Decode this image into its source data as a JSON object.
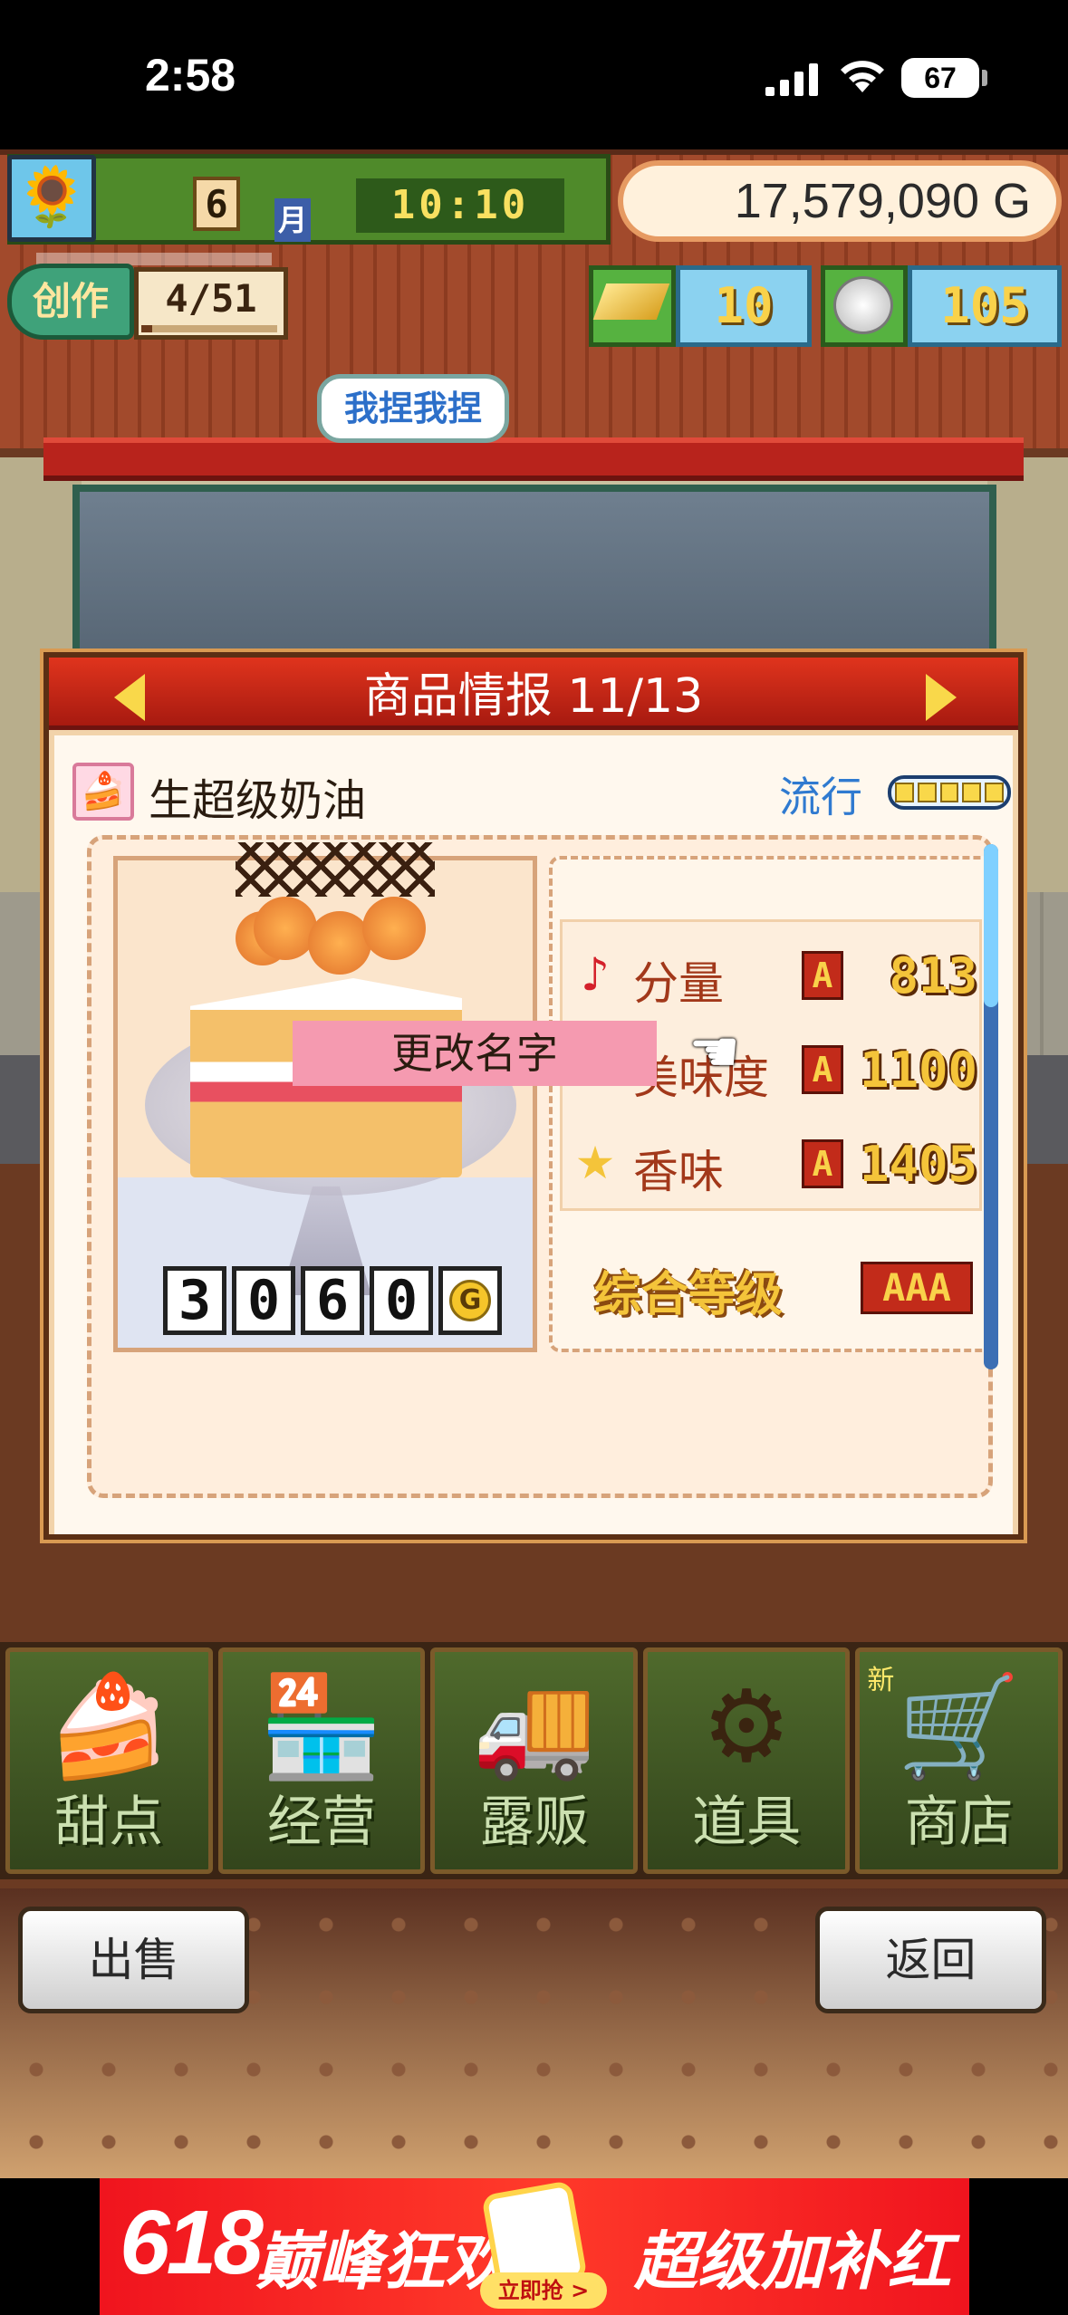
{
  "status_bar": {
    "time": "2:58",
    "battery": "67"
  },
  "hud": {
    "month": "6",
    "month_label": "月",
    "clock": "10:10",
    "money": "17,579,090 G",
    "create_label": "创作",
    "create_count": "4/51",
    "create_progress": 0.08,
    "gold_count": "10",
    "coin_count": "105"
  },
  "speech_bubble": "我捏我捏",
  "dialog": {
    "title": "商品情报 11/13",
    "product_name": "生超级奶油",
    "trend_label": "流行",
    "trend_level": 5,
    "price_digits": [
      "3",
      "0",
      "6",
      "0"
    ],
    "price_unit": "G",
    "stats": [
      {
        "icon": "music-note-icon",
        "glyph": "♪",
        "color": "#d4202a",
        "label": "分量",
        "grade": "A",
        "value": "813"
      },
      {
        "icon": "heart-icon",
        "glyph": "♥",
        "color": "#ff4fa0",
        "label": "美味度",
        "grade": "A",
        "value": "1100"
      },
      {
        "icon": "star-icon",
        "glyph": "★",
        "color": "#f4c43a",
        "label": "香味",
        "grade": "A",
        "value": "1405"
      }
    ],
    "overall_label": "综合等级",
    "overall_grade": "AAA",
    "rename_label": "更改名字"
  },
  "menu": [
    {
      "label": "甜点",
      "icon": "cake-icon",
      "glyph": "🍰",
      "new": ""
    },
    {
      "label": "经营",
      "icon": "shop-icon",
      "glyph": "🏪",
      "new": ""
    },
    {
      "label": "露贩",
      "icon": "food-truck-icon",
      "glyph": "🚚",
      "new": ""
    },
    {
      "label": "道具",
      "icon": "gear-bag-icon",
      "glyph": "⚙",
      "new": ""
    },
    {
      "label": "商店",
      "icon": "shopping-cart-icon",
      "glyph": "🛒",
      "new": "新"
    }
  ],
  "buttons": {
    "sell": "出售",
    "back": "返回"
  },
  "ad": {
    "number": "618",
    "left_text": "巅峰狂欢",
    "cta": "立即抢 >",
    "right_text": "超级加补红包"
  }
}
